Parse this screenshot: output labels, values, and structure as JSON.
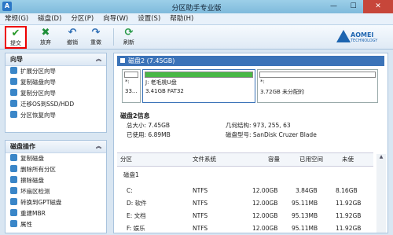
{
  "window": {
    "title": "分区助手专业版",
    "app_icon": "A",
    "minimize": "—",
    "maximize": "☐",
    "close": "✕"
  },
  "menu": [
    "常规(G)",
    "磁盘(D)",
    "分区(P)",
    "向导(W)",
    "设置(S)",
    "帮助(H)"
  ],
  "toolbar": {
    "commit": {
      "label": "提交",
      "icon": "✔"
    },
    "discard": {
      "label": "放弃",
      "icon": "✖"
    },
    "undo": {
      "label": "撤销",
      "icon": "↶"
    },
    "redo": {
      "label": "重做",
      "icon": "↷"
    },
    "refresh": {
      "label": "刷新",
      "icon": "⟳"
    },
    "logo": {
      "name": "AOMEI",
      "sub": "TECHNOLOGY"
    }
  },
  "wizard_panel": {
    "title": "向导",
    "items": [
      "扩展分区向导",
      "复制磁盘向导",
      "复制分区向导",
      "迁移OS到SSD/HDD",
      "分区恢复向导"
    ]
  },
  "disk_ops_panel": {
    "title": "磁盘操作",
    "items": [
      "复制磁盘",
      "删除所有分区",
      "擦除磁盘",
      "坏扇区检测",
      "转换到GPT磁盘",
      "重建MBR",
      "属性"
    ]
  },
  "disk": {
    "header": "磁盘2 (7.45GB)",
    "partitions": [
      {
        "letter": "*:",
        "size": "33...",
        "fill": 0.0
      },
      {
        "letter": "J: 老毛桃U盘",
        "size": "3.41GB FAT32",
        "fill": 1.0
      },
      {
        "letter": "*:",
        "size": "3.72GB 未分配的",
        "fill": 0.0
      }
    ],
    "info_title": "磁盘2信息",
    "info": [
      {
        "label": "总大小: 7.45GB"
      },
      {
        "label": "已使用: 6.89MB"
      },
      {
        "label": "几何结构: 973, 255, 63"
      },
      {
        "label": "磁盘型号: SanDisk Cruzer Blade"
      }
    ]
  },
  "table": {
    "columns": [
      "分区",
      "文件系统",
      "容量",
      "已用空间",
      "未使"
    ],
    "group": "磁盘1",
    "rows": [
      {
        "name": "C:",
        "fs": "NTFS",
        "cap": "12.00GB",
        "used": "3.84GB",
        "free": "8.16GB"
      },
      {
        "name": "D: 软件",
        "fs": "NTFS",
        "cap": "12.00GB",
        "used": "95.11MB",
        "free": "11.92GB"
      },
      {
        "name": "E: 文档",
        "fs": "NTFS",
        "cap": "12.00GB",
        "used": "95.13MB",
        "free": "11.92GB"
      },
      {
        "name": "F: 娱乐",
        "fs": "NTFS",
        "cap": "12.00GB",
        "used": "95.11MB",
        "free": "11.92GB"
      }
    ]
  }
}
